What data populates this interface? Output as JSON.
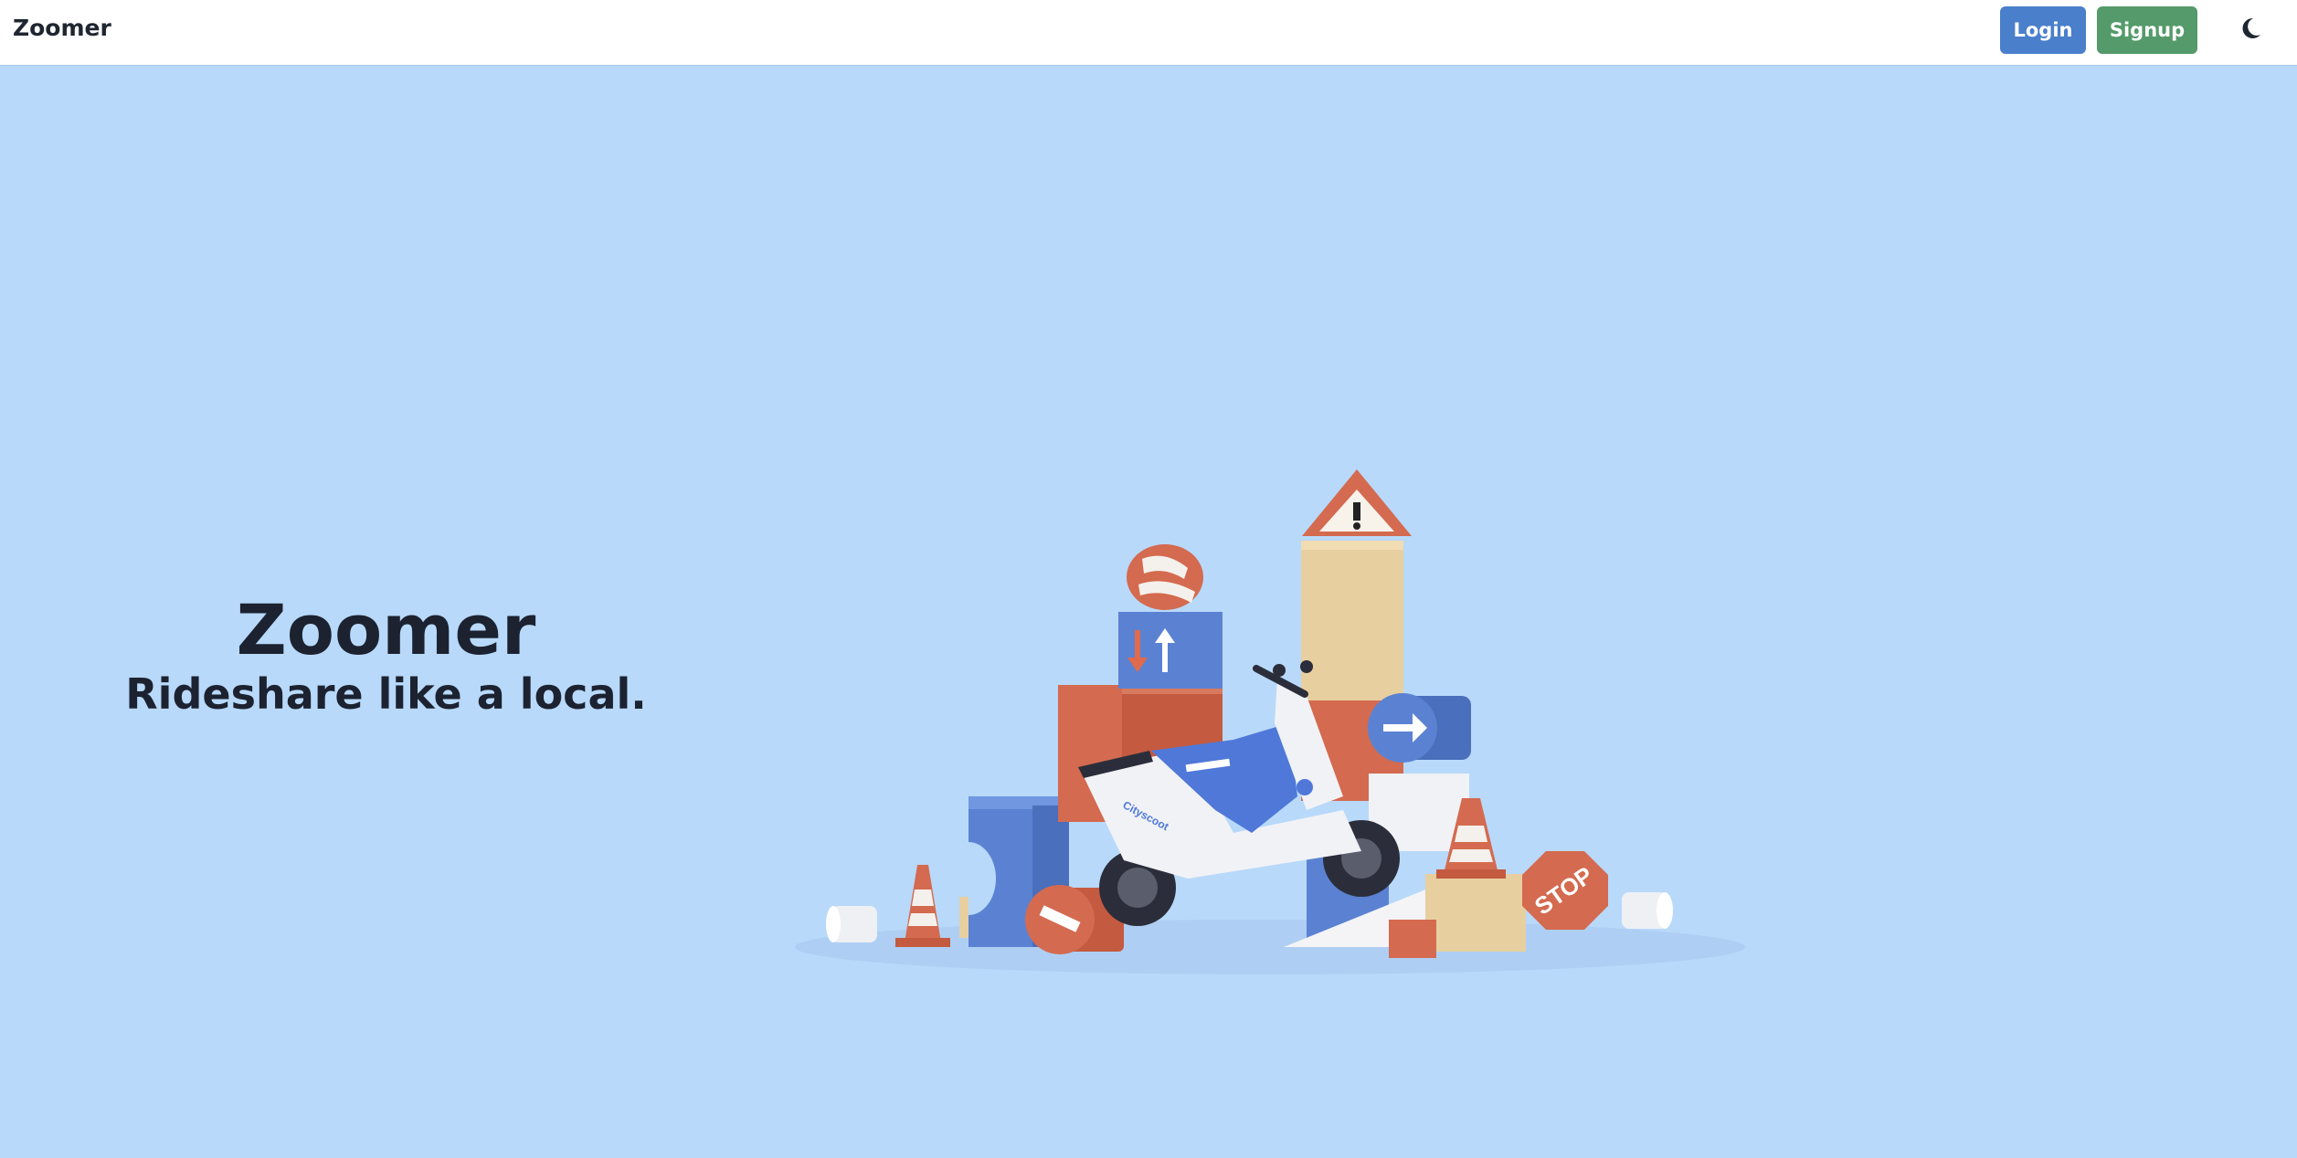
{
  "navbar": {
    "brand": "Zoomer",
    "login_label": "Login",
    "signup_label": "Signup",
    "theme_toggle_icon": "moon-icon"
  },
  "hero": {
    "title": "Zoomer",
    "subtitle": "Rideshare like a local.",
    "illustration": {
      "sign_text": "STOP",
      "scooter_brand": "Cityscoot"
    }
  },
  "colors": {
    "page_background": "#b8d9fa",
    "navbar_background": "#ffffff",
    "login_button": "#4a7fcb",
    "signup_button": "#549a6a",
    "text_dark": "#1c2230",
    "block_red": "#d46a4f",
    "block_blue": "#5b82d2",
    "block_tan": "#e8cfa0"
  }
}
